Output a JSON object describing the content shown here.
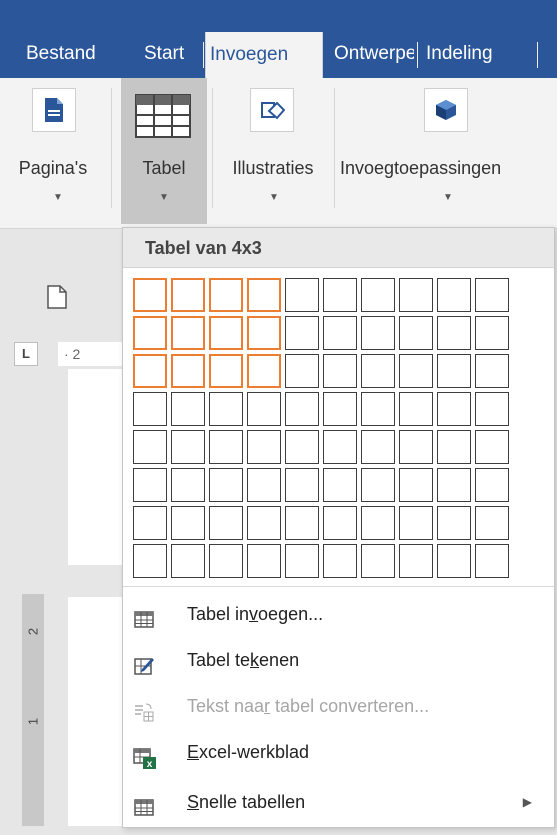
{
  "tabs": {
    "bestand": "Bestand",
    "start": "Start",
    "invoegen": "Invoegen",
    "ontwerpen": "Ontwerpe",
    "indeling": "Indeling"
  },
  "ribbon": {
    "paginas": "Pagina's",
    "tabel": "Tabel",
    "illustraties": "Illustraties",
    "invoegtoepassingen": "Invoegtoepassingen"
  },
  "ruler": {
    "h_marker": "· 2",
    "v_marks": [
      "2",
      "1"
    ]
  },
  "dropdown": {
    "header": "Tabel van 4x3",
    "grid": {
      "columns": 10,
      "rows": 8,
      "selected_cols": 4,
      "selected_rows": 3
    },
    "items": [
      {
        "label_a": "Tabel in",
        "label_u": "v",
        "label_b": "oegen...",
        "icon": "table-grid-icon",
        "disabled": false
      },
      {
        "label_a": "Tabel te",
        "label_u": "k",
        "label_b": "enen",
        "icon": "draw-table-pencil-icon",
        "disabled": false
      },
      {
        "label_a": "Tekst naa",
        "label_u": "r",
        "label_b": " tabel converteren...",
        "icon": "text-to-table-icon",
        "disabled": true
      },
      {
        "label_a": "",
        "label_u": "E",
        "label_b": "xcel-werkblad",
        "icon": "excel-sheet-icon",
        "disabled": false
      },
      {
        "label_a": "",
        "label_u": "S",
        "label_b": "nelle tabellen",
        "icon": "quick-tables-icon",
        "disabled": false,
        "submenu": true
      }
    ]
  },
  "colors": {
    "accent": "#2b579a",
    "selection": "#ed7d31",
    "excel_green": "#217346"
  }
}
